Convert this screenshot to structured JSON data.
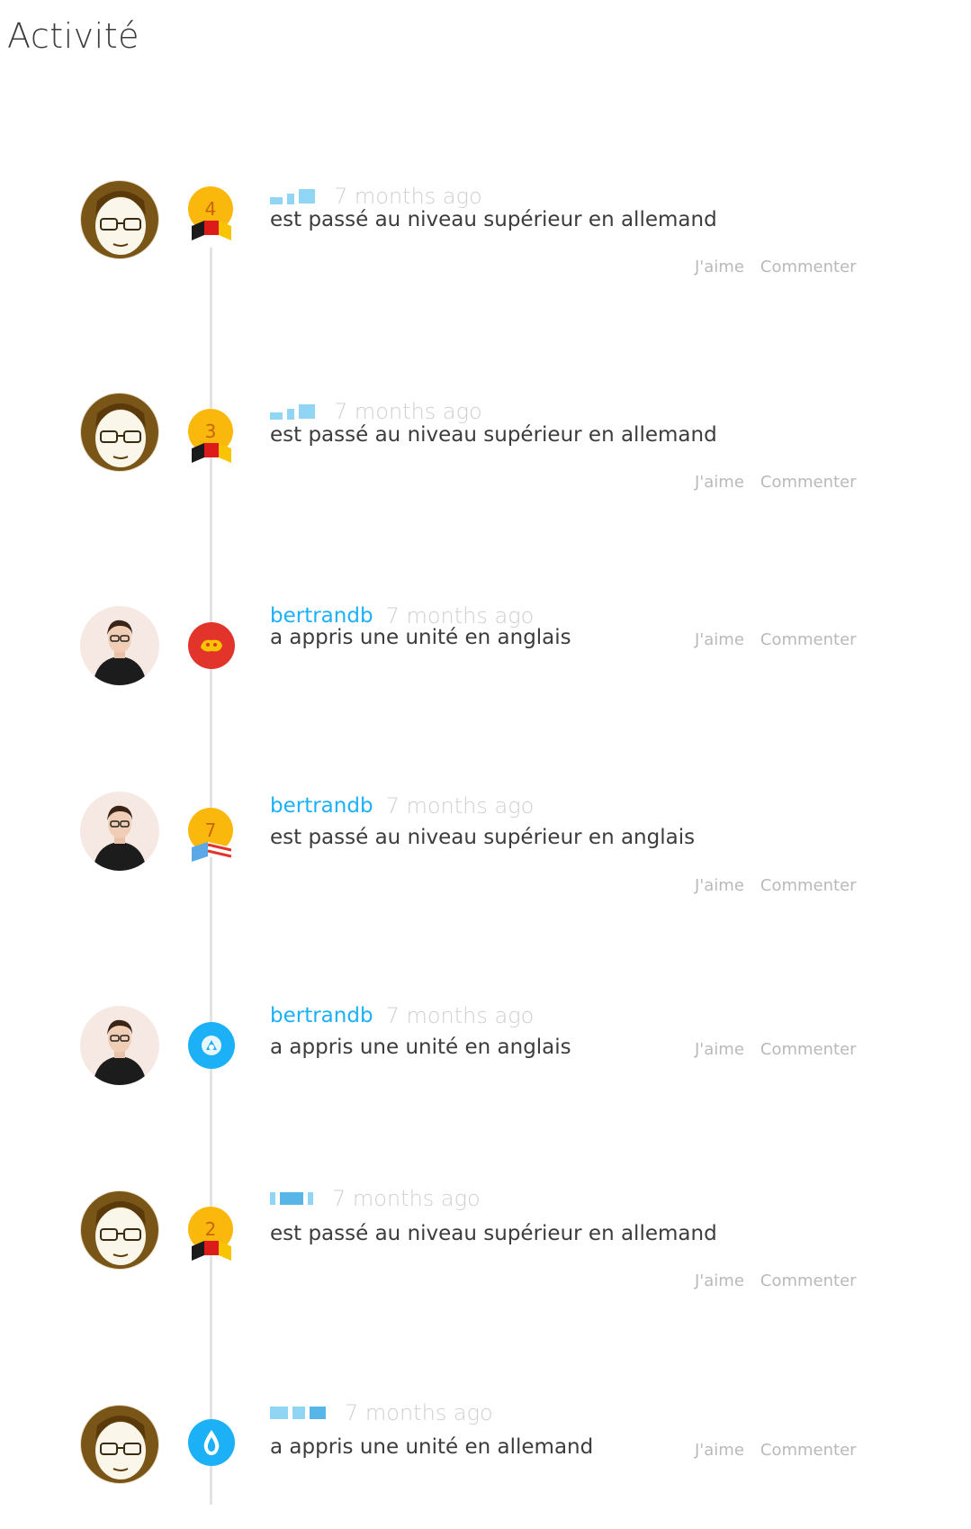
{
  "page": {
    "title": "Activité"
  },
  "actions": {
    "like_label": "J'aime",
    "comment_label": "Commenter"
  },
  "colors": {
    "link": "#1cb0f6",
    "medal": "#fbb80c",
    "muted": "#b9b9b9"
  },
  "entries": [
    {
      "user": "",
      "user_hidden": true,
      "time": "7 months ago",
      "message": "est passé au niveau supérieur en allemand",
      "badge_type": "level-medal",
      "level": "4",
      "avatar": "glasses-avatar",
      "flag": "german-flag"
    },
    {
      "user": "",
      "user_hidden": true,
      "time": "7 months ago",
      "message": "est passé au niveau supérieur en allemand",
      "badge_type": "level-medal",
      "level": "3",
      "avatar": "glasses-avatar",
      "flag": "german-flag"
    },
    {
      "user": "bertrandb",
      "user_hidden": false,
      "time": "7 months ago",
      "message": "a appris une unité en anglais",
      "badge_type": "skill-red",
      "avatar": "photo-avatar"
    },
    {
      "user": "bertrandb",
      "user_hidden": false,
      "time": "7 months ago",
      "message": "est passé au niveau supérieur en anglais",
      "badge_type": "level-medal",
      "level": "7",
      "avatar": "photo-avatar",
      "flag": "us-flag"
    },
    {
      "user": "bertrandb",
      "user_hidden": false,
      "time": "7 months ago",
      "message": "a appris une unité en anglais",
      "badge_type": "skill-blue",
      "avatar": "photo-avatar"
    },
    {
      "user": "",
      "user_hidden": true,
      "time": "7 months ago",
      "message": "est passé au niveau supérieur en allemand",
      "badge_type": "level-medal",
      "level": "2",
      "avatar": "glasses-avatar",
      "flag": "german-flag"
    },
    {
      "user": "",
      "user_hidden": true,
      "time": "7 months ago",
      "message": "a appris une unité en allemand",
      "badge_type": "skill-blue-drop",
      "avatar": "glasses-avatar"
    }
  ]
}
